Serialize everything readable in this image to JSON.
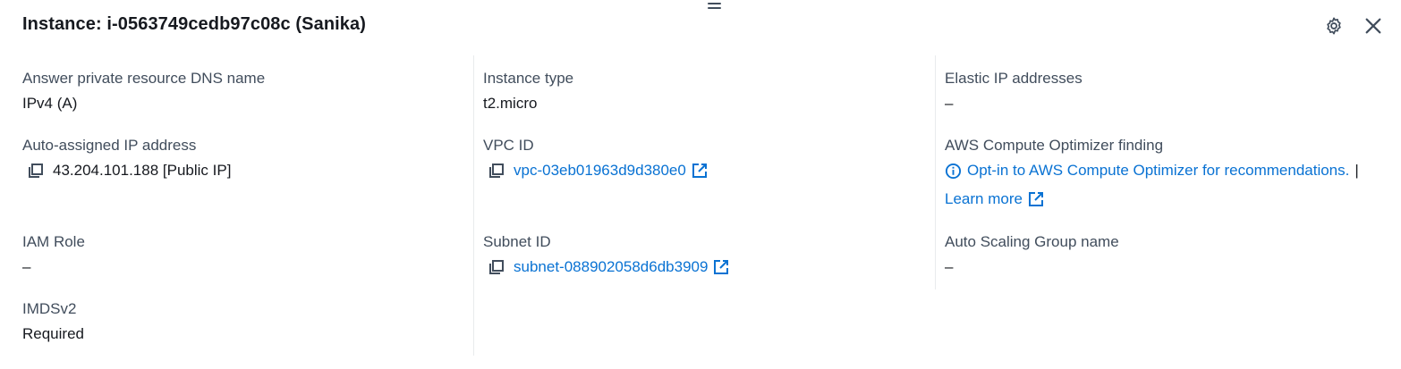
{
  "header": {
    "title": "Instance: i-0563749cedb97c08c (Sanika)"
  },
  "col1": {
    "dns": {
      "label": "Answer private resource DNS name",
      "value": "IPv4 (A)"
    },
    "ip": {
      "label": "Auto-assigned IP address",
      "value": "43.204.101.188 [Public IP]"
    },
    "iam": {
      "label": "IAM Role",
      "value": "–"
    },
    "imds": {
      "label": "IMDSv2",
      "value": "Required"
    }
  },
  "col2": {
    "type": {
      "label": "Instance type",
      "value": "t2.micro"
    },
    "vpc": {
      "label": "VPC ID",
      "value": "vpc-03eb01963d9d380e0"
    },
    "subnet": {
      "label": "Subnet ID",
      "value": "subnet-088902058d6db3909"
    }
  },
  "col3": {
    "eip": {
      "label": "Elastic IP addresses",
      "value": "–"
    },
    "optimizer": {
      "label": "AWS Compute Optimizer finding",
      "link": "Opt-in to AWS Compute Optimizer for recommendations.",
      "separator": "|",
      "learn_more": "Learn more"
    },
    "asg": {
      "label": "Auto Scaling Group name",
      "value": "–"
    }
  },
  "colors": {
    "link": "#0972d3",
    "text": "#16191f",
    "label": "#414d5c",
    "divider": "#e9ebed"
  },
  "icons": [
    "drag-handle-icon",
    "gear-icon",
    "close-icon",
    "copy-icon",
    "external-link-icon",
    "info-icon"
  ]
}
